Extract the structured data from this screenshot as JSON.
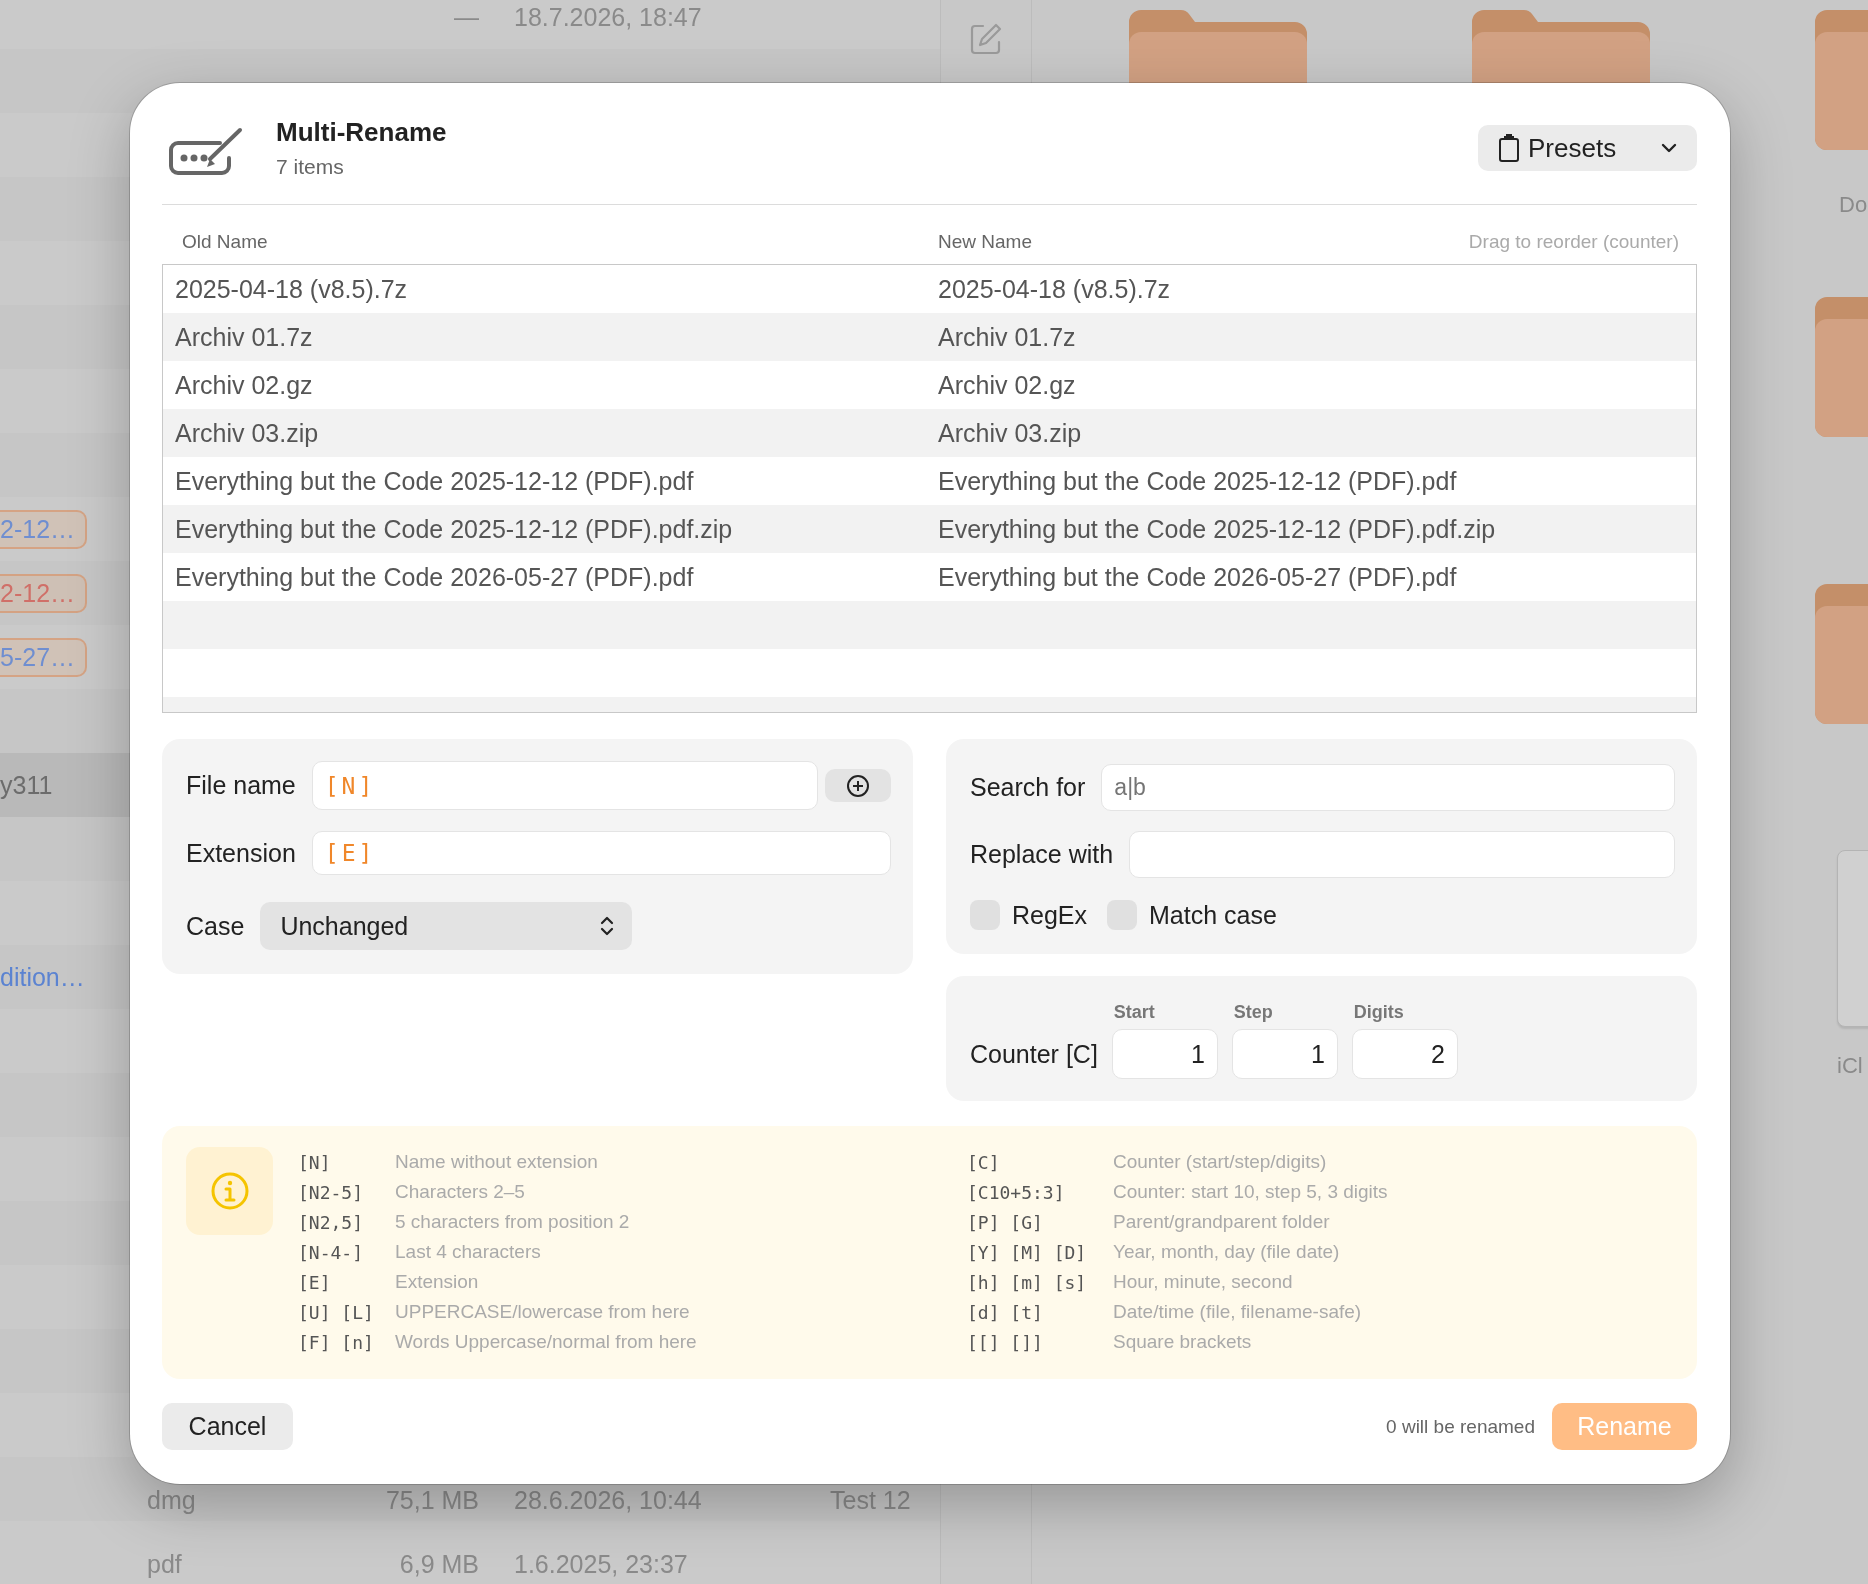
{
  "background": {
    "file_list": {
      "rows": [
        {
          "kind": "date",
          "selected": false,
          "size": "—",
          "date": "18.7.2026, 18:47"
        },
        {
          "kind": "empty",
          "selected": false
        },
        {
          "kind": "empty",
          "selected": false
        },
        {
          "kind": "empty",
          "selected": false
        },
        {
          "kind": "empty",
          "selected": false
        },
        {
          "kind": "empty",
          "selected": false
        },
        {
          "kind": "empty",
          "selected": false
        },
        {
          "kind": "empty",
          "selected": false
        },
        {
          "kind": "tag",
          "selected": false,
          "text": "2-12…",
          "color": "#6f8ed0"
        },
        {
          "kind": "tag",
          "selected": false,
          "text": "2-12…",
          "color": "#d06f68"
        },
        {
          "kind": "tag",
          "selected": false,
          "text": "5-27…",
          "color": "#6f8ed0"
        },
        {
          "kind": "empty",
          "selected": false
        },
        {
          "kind": "label",
          "selected": true,
          "text": "y311"
        },
        {
          "kind": "empty",
          "selected": false
        },
        {
          "kind": "empty",
          "selected": false
        },
        {
          "kind": "link",
          "selected": false,
          "text": "dition…"
        },
        {
          "kind": "empty",
          "selected": false
        },
        {
          "kind": "empty",
          "selected": false
        },
        {
          "kind": "empty",
          "selected": false
        },
        {
          "kind": "empty",
          "selected": false
        },
        {
          "kind": "empty",
          "selected": false
        },
        {
          "kind": "empty",
          "selected": false
        },
        {
          "kind": "empty",
          "selected": false
        },
        {
          "kind": "file",
          "selected": false,
          "type": "dmg",
          "size": "75,1 MB",
          "date": "28.6.2026, 10:44",
          "name": "Test 12"
        },
        {
          "kind": "file",
          "selected": false,
          "type": "pdf",
          "size": "6,9 MB",
          "date": "1.6.2025, 23:37"
        }
      ]
    },
    "icon_columns": [
      [
        {
          "kind": "folder"
        }
      ],
      [
        {
          "kind": "folder"
        }
      ],
      [
        {
          "kind": "folder",
          "label": "Do"
        },
        {
          "kind": "folder"
        },
        {
          "kind": "folder"
        },
        {
          "kind": "drive",
          "label": "iCl"
        }
      ]
    ]
  },
  "dialog": {
    "title": "Multi-Rename",
    "subtitle": "7 items",
    "presets_button": {
      "label": "Presets"
    },
    "table": {
      "columns": [
        "Old Name",
        "New Name"
      ],
      "hint": "Drag to reorder (counter)",
      "rows": [
        {
          "old": "2025-04-18 (v8.5).7z",
          "new": "2025-04-18 (v8.5).7z"
        },
        {
          "old": "Archiv 01.7z",
          "new": "Archiv 01.7z"
        },
        {
          "old": "Archiv 02.gz",
          "new": "Archiv 02.gz"
        },
        {
          "old": "Archiv 03.zip",
          "new": "Archiv 03.zip"
        },
        {
          "old": "Everything but the Code 2025-12-12 (PDF).pdf",
          "new": "Everything but the Code 2025-12-12 (PDF).pdf"
        },
        {
          "old": "Everything but the Code 2025-12-12 (PDF).pdf.zip",
          "new": "Everything but the Code 2025-12-12 (PDF).pdf.zip"
        },
        {
          "old": "Everything but the Code 2026-05-27 (PDF).pdf",
          "new": "Everything but the Code 2026-05-27 (PDF).pdf"
        }
      ]
    },
    "name_panel": {
      "fields": [
        {
          "kind": "text-add",
          "label": "File name",
          "value": "[N]"
        },
        {
          "kind": "text",
          "label": "Extension",
          "value": "[E]"
        },
        {
          "kind": "select",
          "label": "Case",
          "value": "Unchanged"
        }
      ]
    },
    "search_panel": {
      "fields": [
        {
          "label": "Search for",
          "placeholder": "a|b"
        },
        {
          "label": "Replace with"
        }
      ],
      "options": [
        {
          "label": "RegEx",
          "checked": false
        },
        {
          "label": "Match case",
          "checked": false
        }
      ]
    },
    "counter": {
      "label": "Counter [C]",
      "fields": [
        {
          "label": "Start",
          "value": "1"
        },
        {
          "label": "Step",
          "value": "1"
        },
        {
          "label": "Digits",
          "value": "2"
        }
      ]
    },
    "help": {
      "left": [
        {
          "code": "[N]",
          "text": "Name without extension"
        },
        {
          "code": "[N2-5]",
          "text": "Characters 2–5"
        },
        {
          "code": "[N2,5]",
          "text": "5 characters from position 2"
        },
        {
          "code": "[N-4-]",
          "text": "Last 4 characters"
        },
        {
          "code": "[E]",
          "text": "Extension"
        },
        {
          "code": "[U] [L]",
          "text": "UPPERCASE/lowercase from here"
        },
        {
          "code": "[F] [n]",
          "text": "Words Uppercase/normal from here"
        }
      ],
      "right": [
        {
          "code": "[C]",
          "text": "Counter (start/step/digits)"
        },
        {
          "code": "[C10+5:3]",
          "text": "Counter: start 10, step 5, 3 digits"
        },
        {
          "code": "[P] [G]",
          "text": "Parent/grandparent folder"
        },
        {
          "code": "[Y] [M] [D]",
          "text": "Year, month, day (file date)"
        },
        {
          "code": "[h] [m] [s]",
          "text": "Hour, minute, second"
        },
        {
          "code": "[d] [t]",
          "text": "Date/time (file, filename-safe)"
        },
        {
          "code": "[[] []]",
          "text": "Square brackets"
        }
      ]
    },
    "footer": {
      "cancel": "Cancel",
      "status": "0 will be renamed",
      "rename": {
        "label": "Rename",
        "disabled": true
      }
    }
  }
}
